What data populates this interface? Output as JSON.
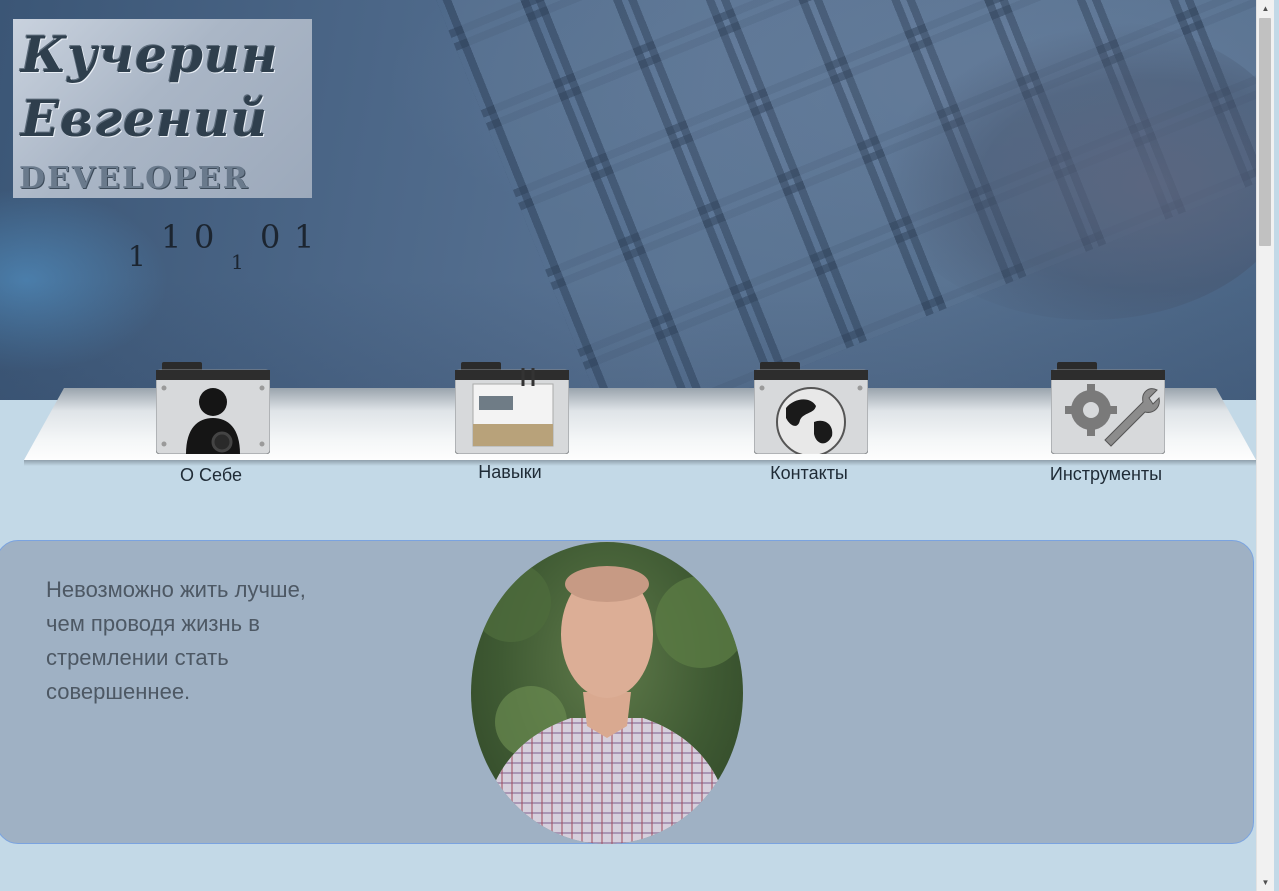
{
  "logo": {
    "line1": "Кучерин",
    "line2": "Евгений",
    "line3": "DEVELOPER"
  },
  "binary_digits": [
    "1",
    "1",
    "0",
    "1",
    "0",
    "1"
  ],
  "nav": {
    "items": [
      {
        "label": "О Себе",
        "icon": "user-folder-icon"
      },
      {
        "label": "Навыки",
        "icon": "skills-folder-icon"
      },
      {
        "label": "Контакты",
        "icon": "globe-folder-icon"
      },
      {
        "label": "Инструменты",
        "icon": "tools-folder-icon"
      }
    ]
  },
  "about": {
    "quote": "Невозможно жить лучше, чем проводя жизнь в стремлении стать совершеннее."
  },
  "colors": {
    "page_background": "#c3d9e7",
    "panel_background": "#9fb1c4",
    "panel_border": "#7aa3e0",
    "header_tint": "#4c6788"
  },
  "scrollbar": {
    "up_arrow": "▲",
    "down_arrow": "▼"
  }
}
